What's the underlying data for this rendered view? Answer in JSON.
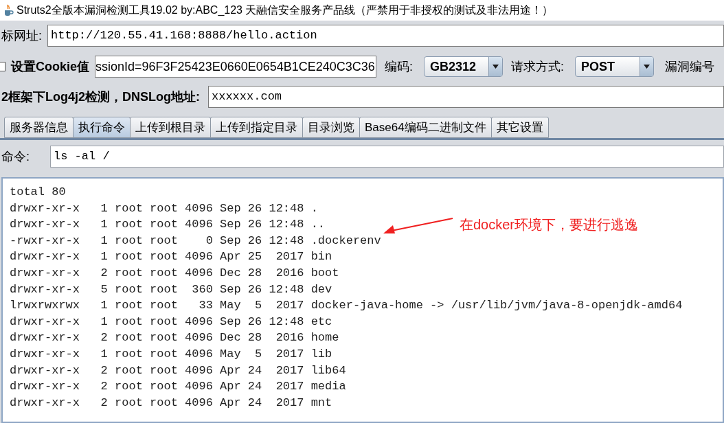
{
  "window": {
    "title": "Struts2全版本漏洞检测工具19.02 by:ABC_123 天融信安全服务产品线（严禁用于非授权的测试及非法用途！）"
  },
  "target_url": {
    "label": "标网址:",
    "value": "http://120.55.41.168:8888/hello.action"
  },
  "cookie": {
    "label": "设置Cookie值",
    "checked": false,
    "value": "ssionId=96F3F25423E0660E0654B1CE240C3C36"
  },
  "encoding": {
    "label": "编码:",
    "value": "GB2312"
  },
  "method": {
    "label": "请求方式:",
    "value": "POST"
  },
  "vuln_id": {
    "label": "漏洞编号"
  },
  "log4j": {
    "label": "2框架下Log4j2检测，DNSLog地址:",
    "value": "xxxxxx.com"
  },
  "tabs": [
    {
      "label": "服务器信息",
      "selected": false
    },
    {
      "label": "执行命令",
      "selected": true
    },
    {
      "label": "上传到根目录",
      "selected": false
    },
    {
      "label": "上传到指定目录",
      "selected": false
    },
    {
      "label": "目录浏览",
      "selected": false
    },
    {
      "label": "Base64编码二进制文件",
      "selected": false
    },
    {
      "label": "其它设置",
      "selected": false
    }
  ],
  "command": {
    "label": "命令:",
    "value": "ls -al /"
  },
  "output": {
    "lines": [
      "total 80",
      "drwxr-xr-x   1 root root 4096 Sep 26 12:48 .",
      "drwxr-xr-x   1 root root 4096 Sep 26 12:48 ..",
      "-rwxr-xr-x   1 root root    0 Sep 26 12:48 .dockerenv",
      "drwxr-xr-x   1 root root 4096 Apr 25  2017 bin",
      "drwxr-xr-x   2 root root 4096 Dec 28  2016 boot",
      "drwxr-xr-x   5 root root  360 Sep 26 12:48 dev",
      "lrwxrwxrwx   1 root root   33 May  5  2017 docker-java-home -> /usr/lib/jvm/java-8-openjdk-amd64",
      "drwxr-xr-x   1 root root 4096 Sep 26 12:48 etc",
      "drwxr-xr-x   2 root root 4096 Dec 28  2016 home",
      "drwxr-xr-x   1 root root 4096 May  5  2017 lib",
      "drwxr-xr-x   2 root root 4096 Apr 24  2017 lib64",
      "drwxr-xr-x   2 root root 4096 Apr 24  2017 media",
      "drwxr-xr-x   2 root root 4096 Apr 24  2017 mnt"
    ]
  },
  "annotation": {
    "text": "在docker环境下，要进行逃逸"
  }
}
